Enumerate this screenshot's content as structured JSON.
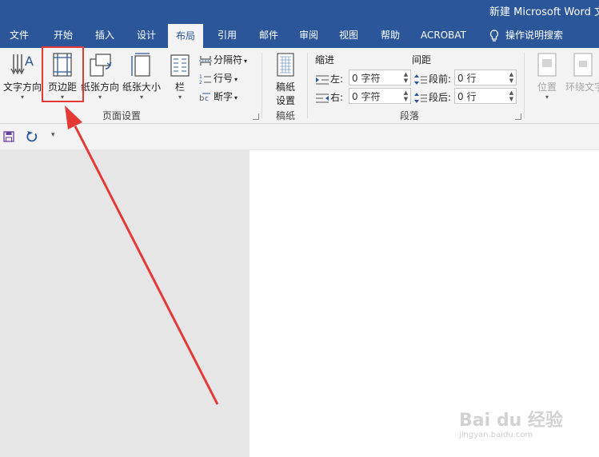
{
  "window": {
    "title": "新建 Microsoft Word 文"
  },
  "tabs": [
    "文件",
    "开始",
    "插入",
    "设计",
    "布局",
    "引用",
    "邮件",
    "审阅",
    "视图",
    "帮助",
    "ACROBAT"
  ],
  "active_tab": "布局",
  "tell_me": "操作说明搜索",
  "ribbon": {
    "page_setup": {
      "text_direction": "文字方向",
      "margins": "页边距",
      "orientation": "纸张方向",
      "size": "纸张大小",
      "columns": "栏",
      "breaks": "分隔符",
      "line_numbers": "行号",
      "hyphenation": "断字",
      "group_label": "页面设置"
    },
    "manuscript": {
      "button_line1": "稿纸",
      "button_line2": "设置",
      "group_label": "稿纸"
    },
    "paragraph": {
      "indent_header": "缩进",
      "spacing_header": "间距",
      "left_label": "左:",
      "right_label": "右:",
      "before_label": "段前:",
      "after_label": "段后:",
      "left_value": "0 字符",
      "right_value": "0 字符",
      "before_value": "0 行",
      "after_value": "0 行",
      "group_label": "段落"
    },
    "arrange": {
      "position": "位置",
      "wrap_text": "环绕文字"
    }
  },
  "watermark": {
    "brand": "Bai du 经验",
    "url": "jingyan.baidu.com"
  },
  "colors": {
    "brand_blue": "#2b579a",
    "annotation_red": "#e53935"
  }
}
